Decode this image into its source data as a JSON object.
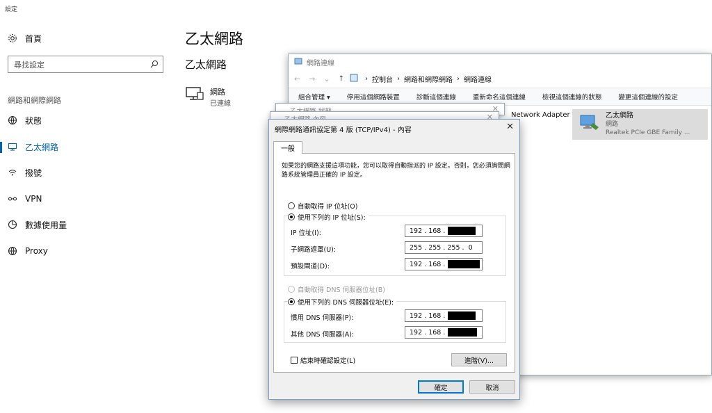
{
  "settings": {
    "app_title": "設定",
    "home_label": "首頁",
    "search_placeholder": "尋找設定",
    "section_label": "網路和網際網路",
    "nav": [
      {
        "label": "狀態",
        "icon": "globe-status-icon"
      },
      {
        "label": "乙太網路",
        "icon": "ethernet-icon",
        "active": true
      },
      {
        "label": "撥號",
        "icon": "dialup-icon"
      },
      {
        "label": "VPN",
        "icon": "vpn-icon"
      },
      {
        "label": "數據使用量",
        "icon": "data-usage-icon"
      },
      {
        "label": "Proxy",
        "icon": "globe-icon"
      }
    ],
    "page_title": "乙太網路",
    "page_subtitle": "乙太網路",
    "network": {
      "name": "網路",
      "status": "已連線"
    },
    "accent_color": "#0063b1"
  },
  "net_connections": {
    "title": "網路連線",
    "breadcrumb": [
      "控制台",
      "網路和網際網路",
      "網路連線"
    ],
    "commands": [
      "組合管理 ▾",
      "停用這個網路裝置",
      "診斷這個連線",
      "重新命名這個連線",
      "檢視這個連線的狀態",
      "變更這個連線的設定"
    ],
    "adapter_left": "Network Adapter",
    "adapter": {
      "name": "乙太網路",
      "status": "網路",
      "device": "Realtek PCIe GBE Family ..."
    }
  },
  "behind_windows": {
    "status_title": "乙太網路 狀態",
    "props_title": "乙太網路 內容"
  },
  "ipv4_dialog": {
    "title": "網際網路通訊協定第 4 版 (TCP/IPv4) - 內容",
    "tab": "一般",
    "description": "如果您的網路支援這項功能，您可以取得自動指派的 IP 設定。否則，您必須詢問網路系統管理員正確的 IP 設定。",
    "auto_ip": "自動取得 IP 位址(O)",
    "manual_ip": "使用下列的 IP 位址(S):",
    "ip_label": "IP 位址(I):",
    "ip_value": "192 . 168 .",
    "subnet_label": "子網路遮罩(U):",
    "subnet_value": "255 . 255 . 255 .  0",
    "gateway_label": "預設閘道(D):",
    "gateway_value": "192 . 168 .",
    "auto_dns": "自動取得 DNS 伺服器位址(B)",
    "manual_dns": "使用下列的 DNS 伺服器位址(E):",
    "dns1_label": "慣用 DNS 伺服器(P):",
    "dns1_value": "192 . 168 .",
    "dns2_label": "其他 DNS 伺服器(A):",
    "dns2_value": "192 . 168 .",
    "validate_label": "結束時確認設定(L)",
    "advanced_label": "進階(V)...",
    "ok_label": "確定",
    "cancel_label": "取消"
  }
}
